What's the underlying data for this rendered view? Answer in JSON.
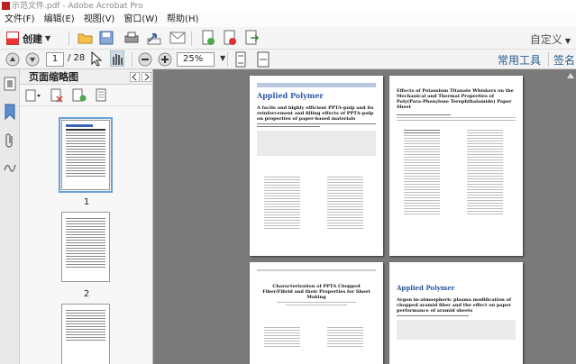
{
  "window": {
    "title": "示范文件.pdf - Adobe Acrobat Pro"
  },
  "menu": [
    "文件(F)",
    "编辑(E)",
    "视图(V)",
    "窗口(W)",
    "帮助(H)"
  ],
  "toolbar": {
    "create_label": "创建",
    "customize_label": "自定义"
  },
  "nav": {
    "current_page": "1",
    "total_pages": "/ 28",
    "zoom": "25%",
    "tools_label": "常用工具",
    "sign_label": "签名"
  },
  "panel": {
    "title": "页面缩略图",
    "thumbs": [
      "1",
      "2"
    ]
  },
  "pages": [
    {
      "journal": "Applied Polymer",
      "article_title": "A facile and highly efficient PPTA-pulp and its reinforcement and filling effects of PPTA-pulp on properties of paper-based materials"
    },
    {
      "article_title": "Effects of Potassium Titanate Whiskers on the Mechanical and Thermal Properties of Poly(Para-Phenylene Terephthalamide) Paper Sheet"
    },
    {
      "article_title": "Characterization of PPTA Chopped Fiber/Fibrid and their Properties for Sheet Making"
    },
    {
      "journal": "Applied Polymer",
      "article_title": "Argon in-atmospheric plasma modification of chopped aramid fiber and the effect on paper performance of aramid sheets"
    }
  ]
}
